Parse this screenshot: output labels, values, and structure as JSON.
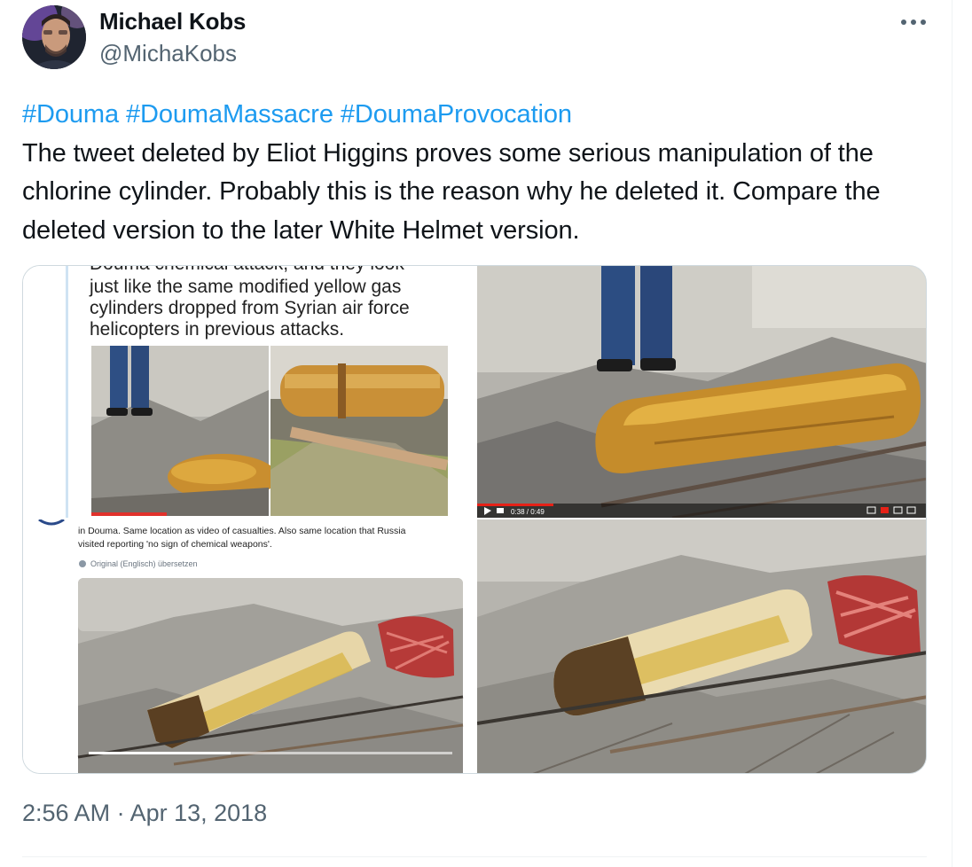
{
  "author": {
    "display_name": "Michael Kobs",
    "handle": "@MichaKobs",
    "avatar_icon": "user-avatar"
  },
  "more_menu": {
    "icon": "ellipsis-icon",
    "glyph": "···"
  },
  "tweet": {
    "hashtags": [
      "#Douma",
      "#DoumaMassacre",
      "#DoumaProvocation"
    ],
    "body": "The tweet deleted by Eliot Higgins proves some serious manipulation of the chlorine cylinder. Probably this is the reason why he deleted it. Compare the deleted version to the later White Helmet version.",
    "timestamp": "2:56 AM · Apr 13, 2018"
  },
  "media": {
    "top_left": {
      "cut_line": "Douma chemical attack, and they look",
      "lines": [
        "just like the same modified yellow gas",
        "cylinders dropped from Syrian air force",
        "helicopters in previous attacks."
      ]
    },
    "top_right": {
      "controls": "0:38 / 0:49"
    },
    "bottom_left": {
      "lines": [
        "in Douma. Same location as video of casualties. Also same location that Russia",
        "visited reporting 'no sign of chemical weapons'."
      ],
      "translate": "Original (Englisch) übersetzen"
    }
  },
  "colors": {
    "link": "#1d9bf0",
    "text": "#0f1419",
    "secondary": "#536471",
    "border": "#cfd9de",
    "cylinder_yellow": "#e3b13a",
    "rubble": "#9a9a95"
  }
}
